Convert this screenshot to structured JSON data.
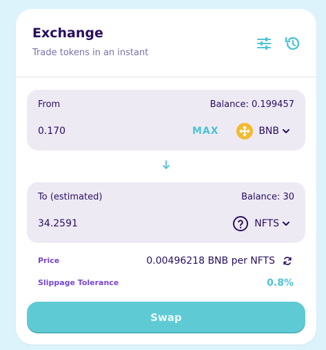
{
  "header": {
    "title": "Exchange",
    "subtitle": "Trade tokens in an instant",
    "settings_icon": "sliders-icon",
    "history_icon": "history-icon"
  },
  "from": {
    "label": "From",
    "balance": "Balance: 0.199457",
    "amount": "0.170",
    "max_label": "MAX",
    "token": "BNB",
    "token_icon": "bnb-icon"
  },
  "to": {
    "label": "To (estimated)",
    "balance": "Balance: 30",
    "amount": "34.2591",
    "token": "NFTS",
    "token_icon": "question-circle-icon"
  },
  "info": {
    "price_label": "Price",
    "price_value": "0.00496218 BNB per NFTS",
    "slippage_label": "Slippage Tolerance",
    "slippage_value": "0.8%"
  },
  "swap_button": "Swap",
  "colors": {
    "background": "#ddf3fb",
    "primary_text": "#280d5f",
    "accent": "#4cc3d4",
    "label_purple": "#7645d9",
    "button": "#5ecad4",
    "bnb": "#f3ba2f"
  }
}
